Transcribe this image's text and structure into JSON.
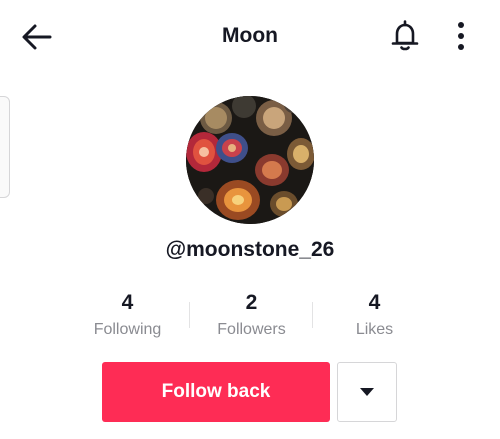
{
  "header": {
    "title": "Moon",
    "back_icon": "arrow-left-icon",
    "bell_icon": "bell-icon",
    "more_icon": "more-vertical-icon"
  },
  "profile": {
    "username": "@moonstone_26",
    "avatar_description_icon": "avatar-image"
  },
  "stats": [
    {
      "value": "4",
      "label": "Following"
    },
    {
      "value": "2",
      "label": "Followers"
    },
    {
      "value": "4",
      "label": "Likes"
    }
  ],
  "actions": {
    "follow_label": "Follow back",
    "dropdown_icon": "caret-down-icon"
  },
  "colors": {
    "accent": "#fe2c55",
    "text": "#161823",
    "secondary_text": "#8a8b91"
  }
}
